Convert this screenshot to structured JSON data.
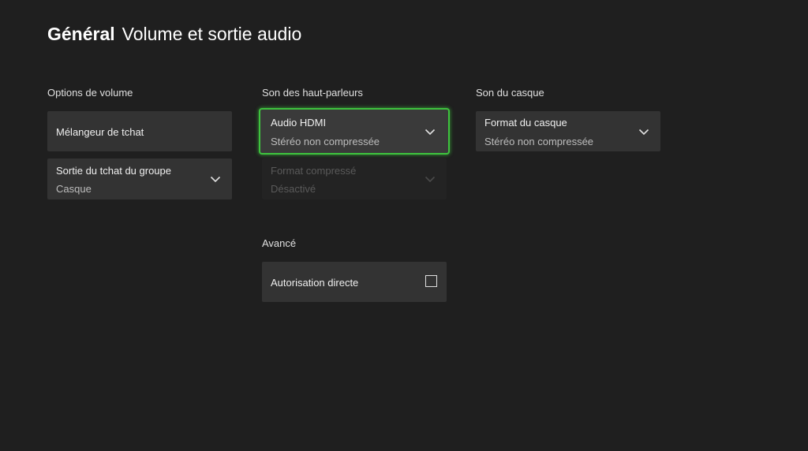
{
  "header": {
    "section": "Général",
    "title": "Volume et sortie audio"
  },
  "columns": {
    "volume": {
      "label": "Options de volume",
      "chat_mixer": {
        "title": "Mélangeur de tchat"
      },
      "party_chat_output": {
        "title": "Sortie du tchat du groupe",
        "value": "Casque"
      }
    },
    "speakers": {
      "label": "Son des haut-parleurs",
      "hdmi_audio": {
        "title": "Audio HDMI",
        "value": "Stéréo non compressée"
      },
      "compressed_format": {
        "title": "Format compressé",
        "value": "Désactivé"
      }
    },
    "headset": {
      "label": "Son du casque",
      "headset_format": {
        "title": "Format du casque",
        "value": "Stéréo non compressée"
      }
    }
  },
  "advanced": {
    "label": "Avancé",
    "passthrough": {
      "title": "Autorisation directe",
      "checked": false
    }
  },
  "icons": {
    "dropdown": "chevron-down-icon",
    "checkbox": "checkbox-unchecked-icon"
  },
  "colors": {
    "background": "#1f1f1f",
    "tile": "#333333",
    "focus": "#3ec33e"
  }
}
